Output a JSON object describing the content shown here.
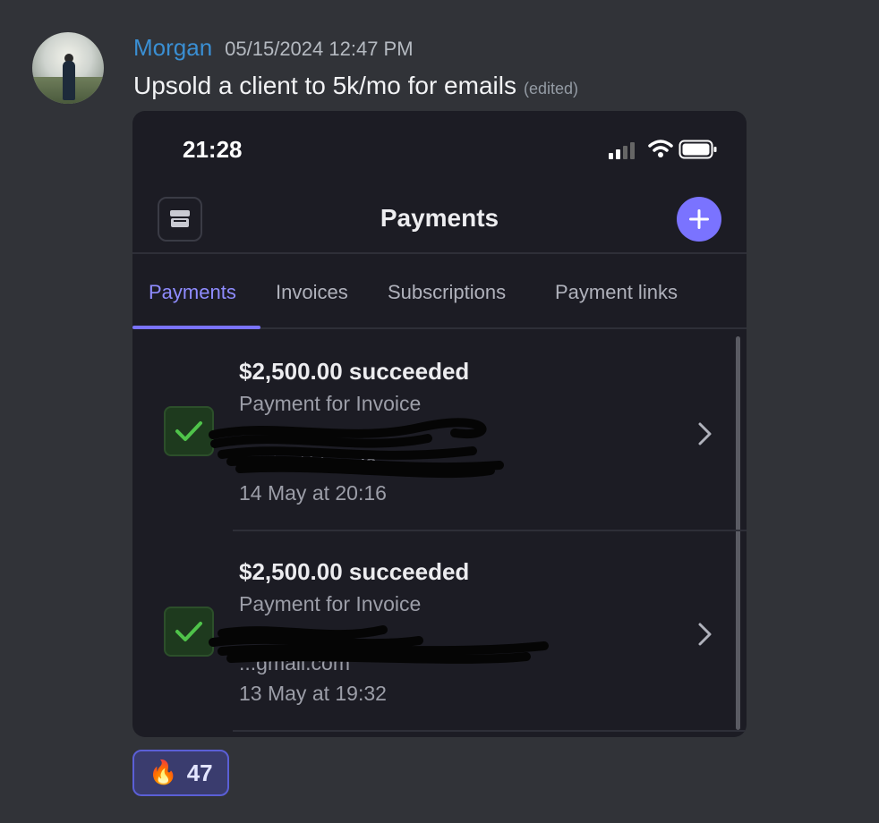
{
  "message": {
    "author": "Morgan",
    "timestamp": "05/15/2024 12:47 PM",
    "text": "Upsold a client to 5k/mo for emails",
    "edited": "(edited)"
  },
  "phone": {
    "status_time": "21:28",
    "nav_title": "Payments",
    "tabs": [
      "Payments",
      "Invoices",
      "Subscriptions",
      "Payment links"
    ],
    "active_tab": "Payments",
    "payments": [
      {
        "amount": "$2,500.00 succeeded",
        "description": "Payment for Invoice",
        "detail": "contact@ ... .io",
        "date": "14 May at 20:16",
        "status": "succeeded"
      },
      {
        "amount": "$2,500.00 succeeded",
        "description": "Payment for Invoice",
        "detail": "...gmail.com",
        "date": "13 May at 19:32",
        "status": "succeeded"
      }
    ]
  },
  "reaction": {
    "emoji": "🔥",
    "count": "47"
  },
  "colors": {
    "background": "#313338",
    "username": "#3a8fd3",
    "accent": "#7a73ff",
    "success": "#4fc34a"
  }
}
